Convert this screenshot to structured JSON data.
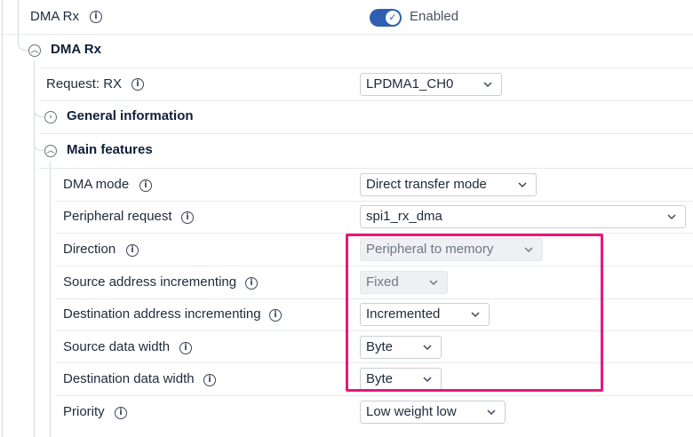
{
  "dma_rx_row": {
    "label": "DMA Rx",
    "toggle_state": "Enabled",
    "toggle_on": true
  },
  "dma_rx_section": {
    "title": "DMA Rx"
  },
  "request_row": {
    "label": "Request: RX",
    "value": "LPDMA1_CH0"
  },
  "general_information": {
    "title": "General information",
    "expanded": false
  },
  "main_features": {
    "title": "Main features",
    "expanded": true
  },
  "rows": [
    {
      "label": "DMA mode",
      "value": "Direct transfer mode",
      "disabled": false
    },
    {
      "label": "Peripheral request",
      "value": "spi1_rx_dma",
      "disabled": false
    },
    {
      "label": "Direction",
      "value": "Peripheral to memory",
      "disabled": true
    },
    {
      "label": "Source address incrementing",
      "value": "Fixed",
      "disabled": true
    },
    {
      "label": "Destination address incrementing",
      "value": "Incremented",
      "disabled": false
    },
    {
      "label": "Source data width",
      "value": "Byte",
      "disabled": false
    },
    {
      "label": "Destination data width",
      "value": "Byte",
      "disabled": false
    },
    {
      "label": "Priority",
      "value": "Low weight low",
      "disabled": false
    }
  ],
  "icons": {
    "info": "info-icon",
    "expand": "chevron-right-icon",
    "collapse": "chevron-up-icon",
    "dropdown": "chevron-down-icon",
    "check": "check-icon"
  },
  "colors": {
    "toggle_on": "#2f5fb0",
    "highlight": "#e5197c",
    "disabled_bg": "#eef0f3"
  }
}
